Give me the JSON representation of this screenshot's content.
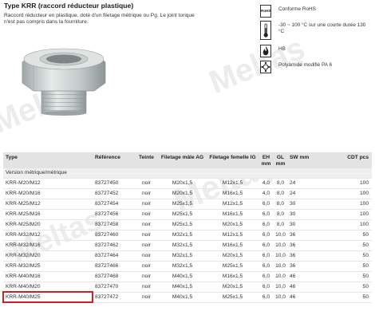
{
  "header": {
    "title": "Type KRR (raccord réducteur plastique)",
    "description": "Raccord réducteur en plastique, doté d'un filetage métrique ou Pg. Le joint torique n'est pas compris dans la fourniture."
  },
  "watermark": "Meltaş",
  "properties": [
    {
      "icon": "rohs-icon",
      "icon_text": "RoHS",
      "text": "Conforme RoHS"
    },
    {
      "icon": "thermometer-icon",
      "icon_text": "",
      "text": "-30 ~ 100 °C sur une courte durée 130 °C"
    },
    {
      "icon": "flame-icon",
      "icon_text": "",
      "text": "HB"
    },
    {
      "icon": "polyamide-icon",
      "icon_text": "",
      "text": "Polyamide modifié PA 6"
    }
  ],
  "table": {
    "headers": {
      "type": "Type",
      "ref": "Référence",
      "teinte": "Teinte",
      "ag": "Filetage mâle AG",
      "ig": "Filetage femelle IG",
      "eh": "EH mm",
      "gl": "GL mm",
      "sw": "SW mm",
      "cdt": "CDT pcs"
    },
    "group": "Version métrique/métrique",
    "rows": [
      {
        "type": "KRR-M20/M12",
        "ref": "83727450",
        "teinte": "noir",
        "ag": "M20x1,5",
        "ig": "M12x1,5",
        "eh": "4,0",
        "gl": "8,0",
        "sw": "24",
        "cdt": "100"
      },
      {
        "type": "KRR-M20/M16",
        "ref": "83727452",
        "teinte": "noir",
        "ag": "M20x1,5",
        "ig": "M16x1,5",
        "eh": "4,0",
        "gl": "8,0",
        "sw": "24",
        "cdt": "100"
      },
      {
        "type": "KRR-M25/M12",
        "ref": "83727454",
        "teinte": "noir",
        "ag": "M25x1,5",
        "ig": "M12x1,5",
        "eh": "6,0",
        "gl": "8,0",
        "sw": "30",
        "cdt": "100"
      },
      {
        "type": "KRR-M25/M16",
        "ref": "83727456",
        "teinte": "noir",
        "ag": "M25x1,5",
        "ig": "M16x1,5",
        "eh": "6,0",
        "gl": "8,0",
        "sw": "30",
        "cdt": "100"
      },
      {
        "type": "KRR-M25/M20",
        "ref": "83727458",
        "teinte": "noir",
        "ag": "M25x1,5",
        "ig": "M20x1,5",
        "eh": "6,0",
        "gl": "8,0",
        "sw": "30",
        "cdt": "100"
      },
      {
        "type": "KRR-M32/M12",
        "ref": "83727460",
        "teinte": "noir",
        "ag": "M32x1,5",
        "ig": "M12x1,5",
        "eh": "6,0",
        "gl": "10,0",
        "sw": "36",
        "cdt": "50"
      },
      {
        "type": "KRR-M32/M16",
        "ref": "83727462",
        "teinte": "noir",
        "ag": "M32x1,5",
        "ig": "M16x1,5",
        "eh": "6,0",
        "gl": "10,0",
        "sw": "36",
        "cdt": "50"
      },
      {
        "type": "KRR-M32/M20",
        "ref": "83727464",
        "teinte": "noir",
        "ag": "M32x1,5",
        "ig": "M20x1,5",
        "eh": "6,0",
        "gl": "10,0",
        "sw": "36",
        "cdt": "50"
      },
      {
        "type": "KRR-M32/M25",
        "ref": "83727466",
        "teinte": "noir",
        "ag": "M32x1,5",
        "ig": "M25x1,5",
        "eh": "6,0",
        "gl": "10,0",
        "sw": "36",
        "cdt": "50"
      },
      {
        "type": "KRR-M40/M16",
        "ref": "83727468",
        "teinte": "noir",
        "ag": "M40x1,5",
        "ig": "M16x1,5",
        "eh": "6,0",
        "gl": "10,0",
        "sw": "46",
        "cdt": "50"
      },
      {
        "type": "KRR-M40/M20",
        "ref": "83727470",
        "teinte": "noir",
        "ag": "M40x1,5",
        "ig": "M20x1,5",
        "eh": "6,0",
        "gl": "10,0",
        "sw": "46",
        "cdt": "50"
      },
      {
        "type": "KRR-M40/M25",
        "ref": "83727472",
        "teinte": "noir",
        "ag": "M40x1,5",
        "ig": "M25x1,5",
        "eh": "6,0",
        "gl": "10,0",
        "sw": "46",
        "cdt": "50",
        "highlighted": true
      }
    ]
  },
  "colors": {
    "highlight_border": "#cc2222",
    "header_bg": "#e3e3e3",
    "watermark": "#d6d6d6"
  }
}
